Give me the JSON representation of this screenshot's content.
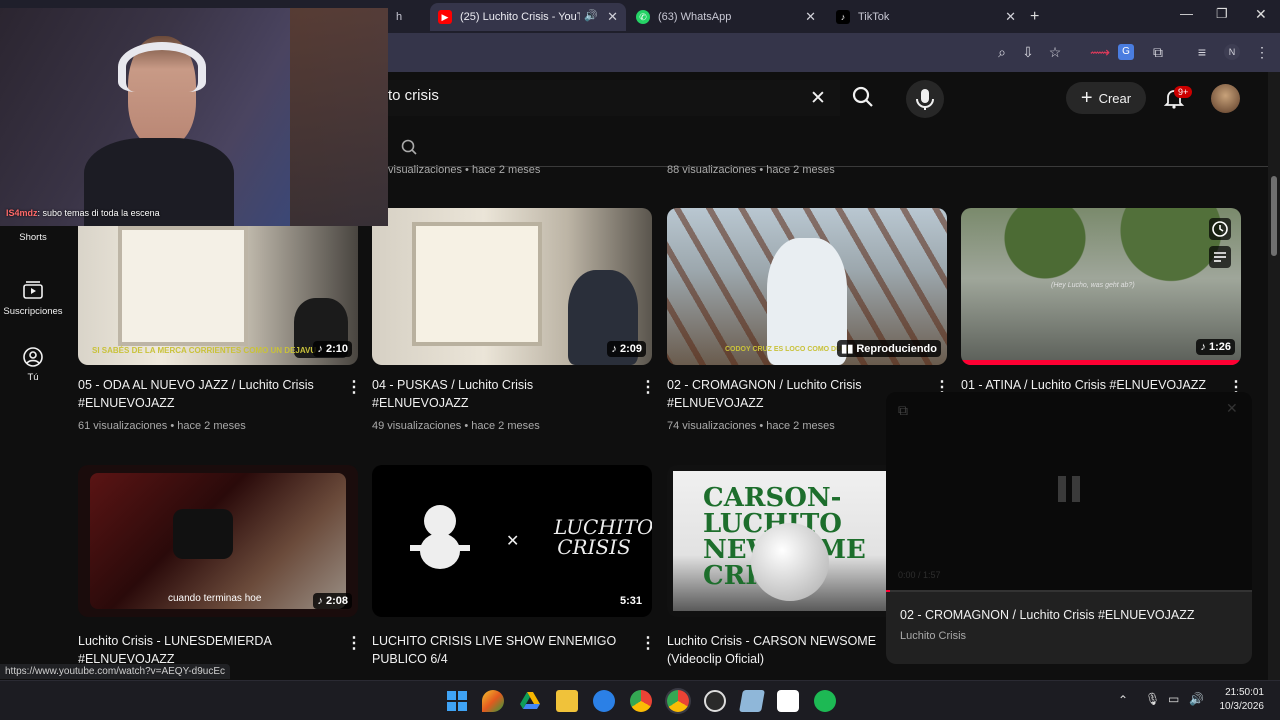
{
  "browser": {
    "tabs": [
      {
        "label": "h",
        "favicon": "youtube"
      },
      {
        "label": "(25) Luchito Crisis - YouTub",
        "favicon": "youtube",
        "active": true
      },
      {
        "label": "(63) WhatsApp",
        "favicon": "whatsapp"
      },
      {
        "label": "TikTok",
        "favicon": "tiktok"
      }
    ],
    "new_tab": "+",
    "profile_initial": "N"
  },
  "youtube": {
    "search_value": "to crisis",
    "create_label": "Crear",
    "notif_count": "9+",
    "sidebar": [
      {
        "label": "Shorts",
        "icon": "shorts-icon"
      },
      {
        "label": "Suscripciones",
        "icon": "subscriptions-icon"
      },
      {
        "label": "Tú",
        "icon": "you-icon"
      }
    ],
    "top_meta": [
      "visualizaciones • hace 2 meses",
      "88 visualizaciones • hace 2 meses"
    ],
    "videos_row1": [
      {
        "title": "05 - ODA AL NUEVO JAZZ / Luchito Crisis #ELNUEVOJAZZ",
        "meta": "61 visualizaciones • hace 2 meses",
        "duration": "2:10"
      },
      {
        "title": "04 - PUSKAS / Luchito Crisis #ELNUEVOJAZZ",
        "meta": "49 visualizaciones • hace 2 meses",
        "duration": "2:09"
      },
      {
        "title": "02 - CROMAGNON / Luchito Crisis #ELNUEVOJAZZ",
        "meta": "74 visualizaciones • hace 2 meses",
        "duration": "Reproduciendo"
      },
      {
        "title": "01 - ATINA / Luchito Crisis #ELNUEVOJAZZ",
        "meta": "",
        "duration": "1:26"
      }
    ],
    "videos_row2": [
      {
        "title": "Luchito Crisis - LUNESDEMIERDA #ELNUEVOJAZZ",
        "duration": "2:08",
        "thumb_caption": "cuando terminas hoe"
      },
      {
        "title": "LUCHITO CRISIS LIVE SHOW ENNEMIGO PUBLICO 6/4",
        "duration": "5:31",
        "thumb_caption": "LUCHITO CRISIS"
      },
      {
        "title": "Luchito Crisis - CARSON NEWSOME (Videoclip Oficial)",
        "duration": "",
        "thumb_caption": "CARSON-LUCHITO NEWSOME CRI"
      }
    ],
    "thumb_captions": {
      "oda": "SI SABÉS DE LA MERCA CORRIENTES COMO UN DEJAVU",
      "cromagnon": "CODOY CRUZ ES LOCO COMO DUKE",
      "atina": "(Hey Lucho, was geht ab?)"
    },
    "miniplayer": {
      "title": "02 - CROMAGNON / Luchito Crisis #ELNUEVOJAZZ",
      "channel": "Luchito Crisis",
      "time": "0:00 / 1:57"
    },
    "status_url": "https://www.youtube.com/watch?v=AEQY-d9ucEc"
  },
  "webcam": {
    "chat_user": "IS4mdz",
    "chat_text": ": subo temas di toda la escena"
  },
  "taskbar": {
    "time": "21:50:01",
    "date": "10/3/2026"
  }
}
